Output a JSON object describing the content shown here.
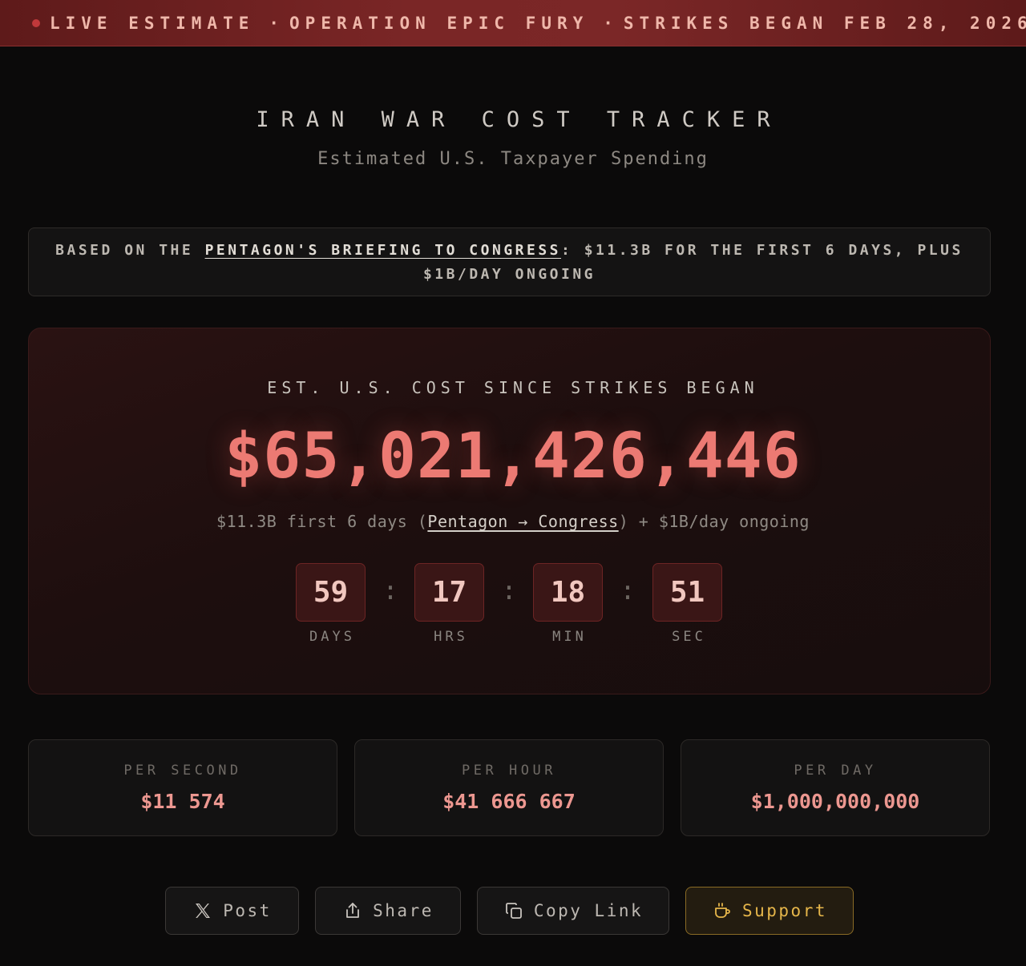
{
  "banner": {
    "live": "LIVE ESTIMATE",
    "operation": "OPERATION EPIC FURY",
    "strikes": "STRIKES BEGAN FEB 28, 2026",
    "separator": "·"
  },
  "header": {
    "title": "IRAN WAR COST TRACKER",
    "subtitle": "Estimated U.S. Taxpayer Spending"
  },
  "notice": {
    "prefix": "BASED ON THE",
    "link": "PENTAGON'S BRIEFING TO CONGRESS",
    "suffix": ": $11.3B FOR THE FIRST 6 DAYS, PLUS",
    "line2": "$1B/DAY ONGOING"
  },
  "main": {
    "label": "EST. U.S. COST SINCE STRIKES BEGAN",
    "cost": "$65,021,426,446",
    "sub_prefix": "$11.3B first 6 days (",
    "sub_link": "Pentagon → Congress",
    "sub_suffix": ") + $1B/day ongoing"
  },
  "timer": {
    "days": "59",
    "hours": "17",
    "minutes": "18",
    "seconds": "51",
    "days_label": "DAYS",
    "hours_label": "HRS",
    "minutes_label": "MIN",
    "seconds_label": "SEC",
    "colon": ":"
  },
  "rates": [
    {
      "label": "PER SECOND",
      "value": "$11 574"
    },
    {
      "label": "PER HOUR",
      "value": "$41 666 667"
    },
    {
      "label": "PER DAY",
      "value": "$1,000,000,000"
    }
  ],
  "actions": {
    "post": "Post",
    "share": "Share",
    "copy": "Copy Link",
    "support": "Support"
  },
  "icons": {
    "post": "x-logo-icon",
    "share": "share-icon",
    "copy": "copy-icon",
    "support": "coffee-cup-icon",
    "live": "live-dot-icon"
  },
  "colors": {
    "accent": "#ec7a73",
    "banner": "#7a2626",
    "support": "#e6b64a"
  }
}
